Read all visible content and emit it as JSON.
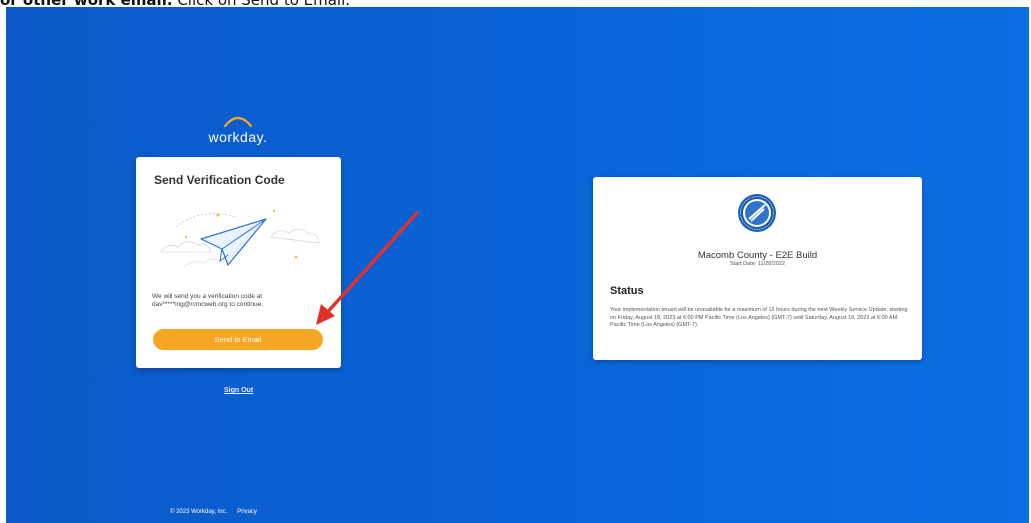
{
  "caption": {
    "bold_text": "or other work email.",
    "normal_text": " Click on Send to Email."
  },
  "logo": {
    "text": "workday."
  },
  "verification_card": {
    "title": "Send Verification Code",
    "message": "We will send you a verification code at dav*****ing@rcmcweb.org   to continue.",
    "button_label": "Send to Email"
  },
  "sign_out": {
    "label": "Sign Out"
  },
  "status_card": {
    "org_name": "Macomb County - E2E Build",
    "start_date": "Start Date: 11/28/2022",
    "heading": "Status",
    "body": "Your implementation tenant will be unavailable for a maximum of 12 hours during the next Weekly Service Update; starting on Friday, August 18, 2023 at 6:00 PM Pacific Time (Los Angeles) (GMT-7) until Saturday, August 19, 2023 at 6:00 AM Pacific Time (Los Angeles) (GMT-7)."
  },
  "footer": {
    "copyright": "© 2023 Workday, Inc.",
    "privacy": "Privacy"
  },
  "colors": {
    "background": "#0a62d5",
    "button": "#f5a623",
    "annotation_arrow": "#e0322d"
  },
  "icons": [
    "workday-logo-arc",
    "paper-plane-illustration",
    "macomb-county-seal-icon",
    "annotation-arrow"
  ]
}
